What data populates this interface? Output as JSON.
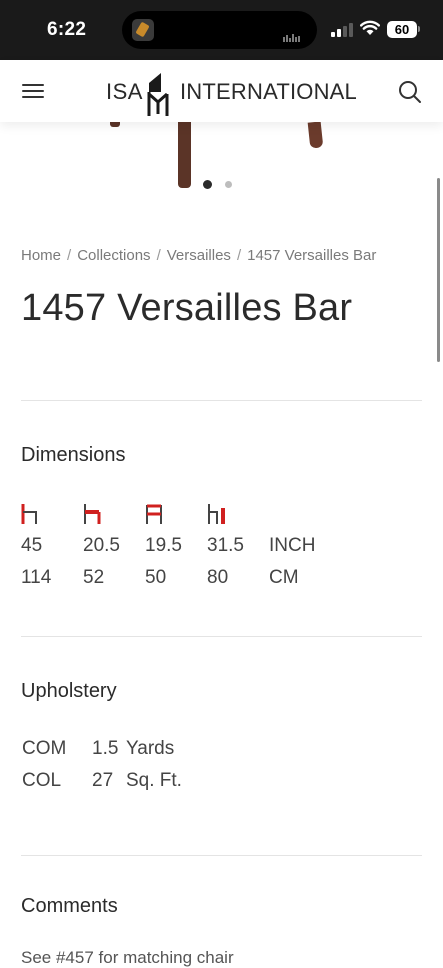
{
  "status_bar": {
    "time": "6:22",
    "battery": "60"
  },
  "header": {
    "logo_left": "ISA",
    "logo_right": "INTERNATIONAL"
  },
  "carousel": {
    "active_index": 0,
    "count": 2
  },
  "breadcrumb": {
    "items": [
      "Home",
      "Collections",
      "Versailles",
      "1457 Versailles Bar"
    ]
  },
  "product": {
    "title": "1457 Versailles Bar"
  },
  "dimensions": {
    "heading": "Dimensions",
    "icons": [
      "overall-height-icon",
      "seat-height-icon",
      "width-icon",
      "depth-icon"
    ],
    "inch": [
      "45",
      "20.5",
      "19.5",
      "31.5"
    ],
    "inch_unit": "INCH",
    "cm": [
      "114",
      "52",
      "50",
      "80"
    ],
    "cm_unit": "CM"
  },
  "upholstery": {
    "heading": "Upholstery",
    "rows": [
      {
        "label": "COM",
        "value": "1.5",
        "unit": "Yards"
      },
      {
        "label": "COL",
        "value": "27",
        "unit": "Sq. Ft."
      }
    ]
  },
  "comments": {
    "heading": "Comments",
    "text": "See #457 for matching chair"
  },
  "colors": {
    "accent_red": "#d0201f",
    "text": "#2b2b2b"
  }
}
